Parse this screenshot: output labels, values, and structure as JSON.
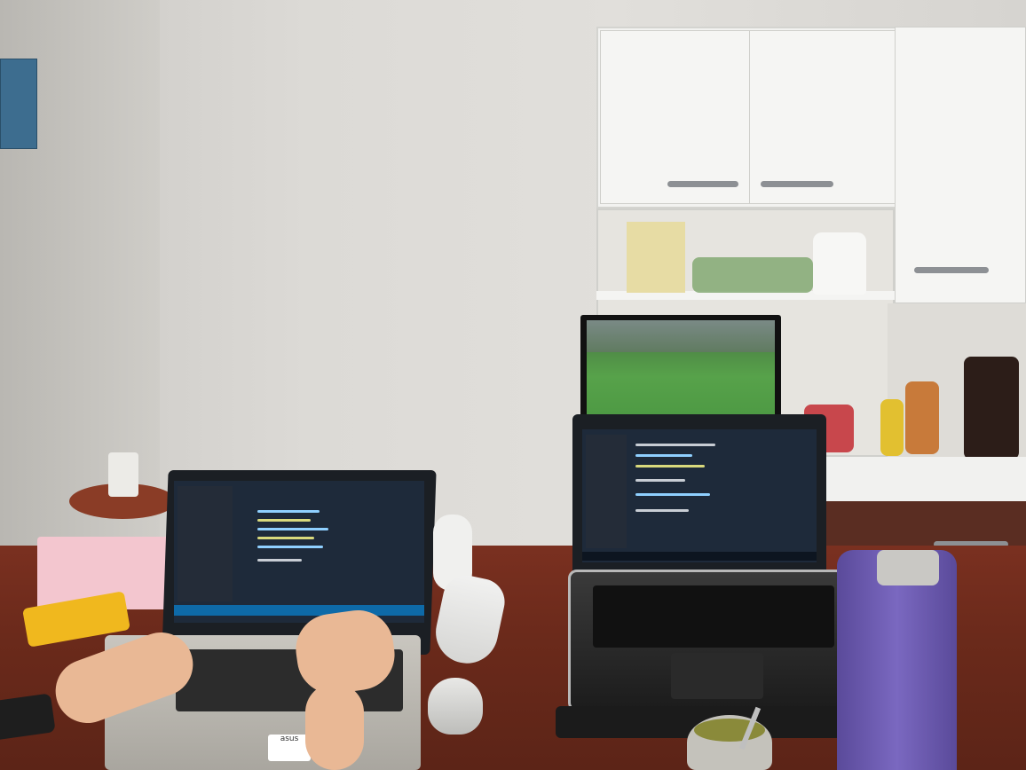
{
  "scene": {
    "description_label": "",
    "colors": {
      "wall": "#e1dfdb",
      "table": "#6b2a1b",
      "cabinet": "#f2f2f0",
      "thermos": "#7a68c0",
      "code_background": "#1e2a3a",
      "pitch": "#57a24a"
    }
  },
  "left_laptop": {
    "brand_label": "asus"
  },
  "right_laptop": {
    "brand_label": ""
  },
  "icons": [
    "laptop-icon",
    "monitor-icon",
    "thermos-icon",
    "mouse-icon"
  ]
}
